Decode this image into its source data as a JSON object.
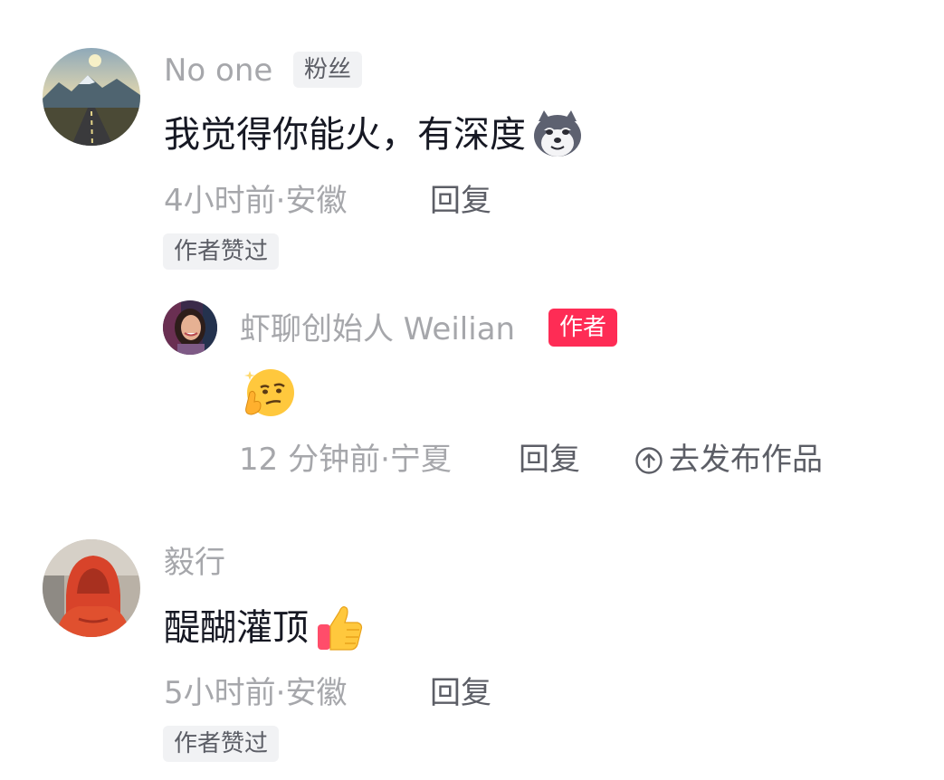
{
  "comments": [
    {
      "username": "No one",
      "badge": "粉丝",
      "text": "我觉得你能火，有深度",
      "emoji": "husky-emoji",
      "meta": "4小时前·安徽",
      "reply_label": "回复",
      "liked_tag": "作者赞过",
      "reply": {
        "username": "虾聊创始人 Weilian",
        "badge": "作者",
        "emoji": "smirk-thinking-emoji",
        "meta": "12 分钟前·宁夏",
        "reply_label": "回复",
        "publish_label": "去发布作品",
        "publish_icon": "arrow-up-circle-icon"
      }
    },
    {
      "username": "毅行",
      "text": "醍醐灌顶",
      "emoji": "thumbs-up-emoji",
      "meta": "5小时前·安徽",
      "reply_label": "回复",
      "liked_tag": "作者赞过"
    }
  ],
  "colors": {
    "author_badge": "#fe2c55",
    "muted_text": "#a6a7ab",
    "secondary_text": "#5c5e66",
    "primary_text": "#161823",
    "tag_bg": "#f1f2f4"
  }
}
